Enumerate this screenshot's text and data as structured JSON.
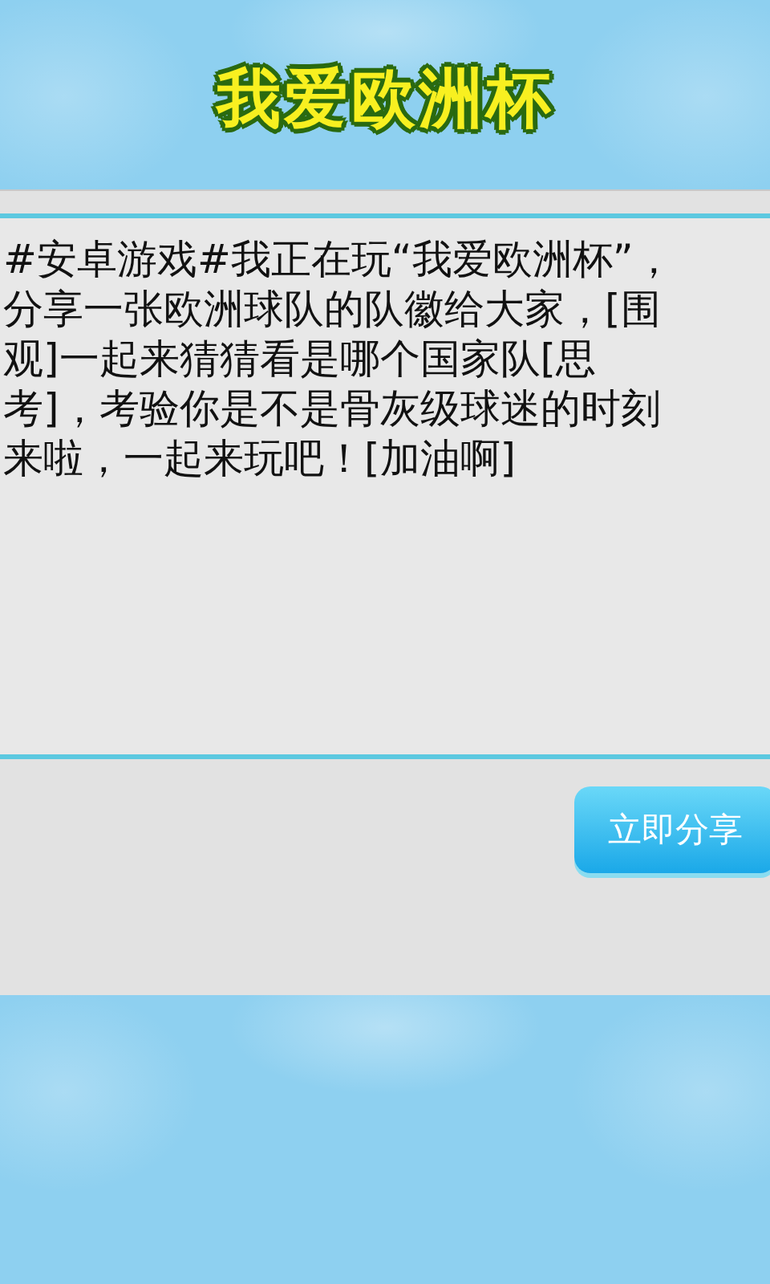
{
  "header": {
    "title": "我爱欧洲杯"
  },
  "message": {
    "lines": [
      "#安卓游戏#我正在玩“我爱欧洲杯”，",
      "分享一张欧洲球队的队徽给大家，[围",
      "观]一起来猜猜看是哪个国家队[思",
      "考]，考验你是不是骨灰级球迷的时刻",
      "来啦，一起来玩吧！[加油啊]"
    ]
  },
  "share_button": {
    "label": "立即分享"
  }
}
